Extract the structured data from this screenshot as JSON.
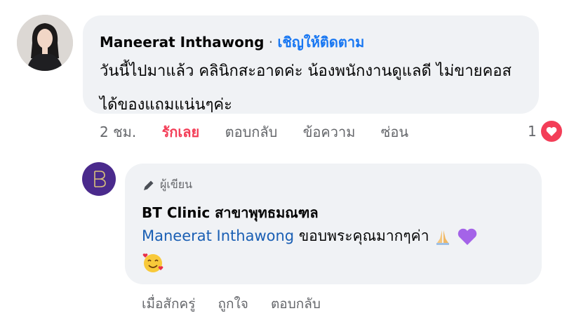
{
  "comment": {
    "author": "Maneerat Inthawong",
    "separator": "·",
    "follow_label": "เชิญให้ติดตาม",
    "text": "วันนี้ไปมาแล้ว คลินิกสะอาดค่ะ น้องพนักงานดูแลดี ไม่ขายคอส ได้ของแถมแน่นๆค่ะ",
    "time": "2 ชม.",
    "love_label": "รักเลย",
    "reply_label": "ตอบกลับ",
    "message_label": "ข้อความ",
    "hide_label": "ซ่อน",
    "reaction_count": "1",
    "reaction_icon": "heart-icon"
  },
  "reply": {
    "badge_label": "ผู้เขียน",
    "badge_icon": "pen-icon",
    "author": "BT Clinic สาขาพุทธมณฑล",
    "mention": "Maneerat Inthawong",
    "text": " ขอบพระคุณมากๆค่า",
    "emojis": [
      "folded-hands",
      "purple-heart",
      "smiling-face-with-hearts"
    ],
    "time": "เมื่อสักครู่",
    "like_label": "ถูกใจ",
    "reply_label": "ตอบกลับ"
  },
  "colors": {
    "bubble": "#f0f2f5",
    "link": "#1877f2",
    "love": "#f33e58",
    "muted": "#65676b",
    "brand": "#4a2a8c"
  }
}
